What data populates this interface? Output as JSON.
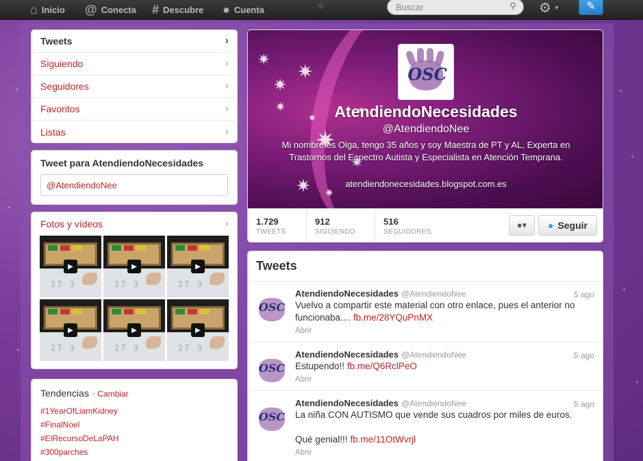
{
  "topbar": {
    "nav": [
      {
        "label": "Inicio",
        "icon": "home-icon"
      },
      {
        "label": "Conecta",
        "icon": "at-icon"
      },
      {
        "label": "Descubre",
        "icon": "hash-icon"
      },
      {
        "label": "Cuenta",
        "icon": "user-icon"
      }
    ],
    "search_placeholder": "Buscar"
  },
  "sidebar": {
    "items": [
      {
        "label": "Tweets",
        "active": true
      },
      {
        "label": "Siguiendo"
      },
      {
        "label": "Seguidores"
      },
      {
        "label": "Favoritos"
      },
      {
        "label": "Listas"
      }
    ]
  },
  "tweet_box": {
    "title": "Tweet para AtendiendoNecesidades",
    "value": "@AtendiendoNee"
  },
  "media": {
    "title": "Fotos y vídeos",
    "thumb_text": "27 3"
  },
  "trends": {
    "title": "Tendencias",
    "separator": "·",
    "change_label": "Cambiar",
    "items": [
      "#1YearOfLiamKidney",
      "#FinalNoel",
      "#ElRecursoDeLaPAH",
      "#300parches"
    ]
  },
  "profile": {
    "logo_text": "OSC",
    "name": "AtendiendoNecesidades",
    "handle": "@AtendiendoNee",
    "bio": "Mi nombre es Olga, tengo 35 años y soy Maestra de PT y AL, Experta en Trastornos del Espectro Autista y Especialista en Atención Temprana.",
    "url": "atendiendonecesidades.blogspot.com.es",
    "stats": [
      {
        "value": "1.729",
        "label": "TWEETS"
      },
      {
        "value": "912",
        "label": "SIGUIENDO"
      },
      {
        "value": "516",
        "label": "SEGUIDORES"
      }
    ],
    "follow_label": "Seguir"
  },
  "stream": {
    "title": "Tweets",
    "open_label": "Abrir",
    "tweets": [
      {
        "name": "AtendiendoNecesidades",
        "handle": "@AtendiendoNee",
        "time": "5 ago",
        "text": "Vuelvo a compartir este material con otro enlace, pues el anterior no funcionaba....",
        "link": "fb.me/28YQuPnMX",
        "extra": ""
      },
      {
        "name": "AtendiendoNecesidades",
        "handle": "@AtendiendoNee",
        "time": "5 ago",
        "text": "Estupendo!!",
        "link": "fb.me/Q6RclPeO",
        "extra": ""
      },
      {
        "name": "AtendiendoNecesidades",
        "handle": "@AtendiendoNee",
        "time": "5 ago",
        "text": "La niña CON AUTISMO que vende sus cuadros por miles de euros.",
        "link": "fb.me/11OtWvrjl",
        "extra": "Qué genial!!!"
      }
    ]
  },
  "colors": {
    "link_red": "#c0212b",
    "background_purple": "#7a3d9a",
    "banner_magenta": "#7b1d78"
  }
}
